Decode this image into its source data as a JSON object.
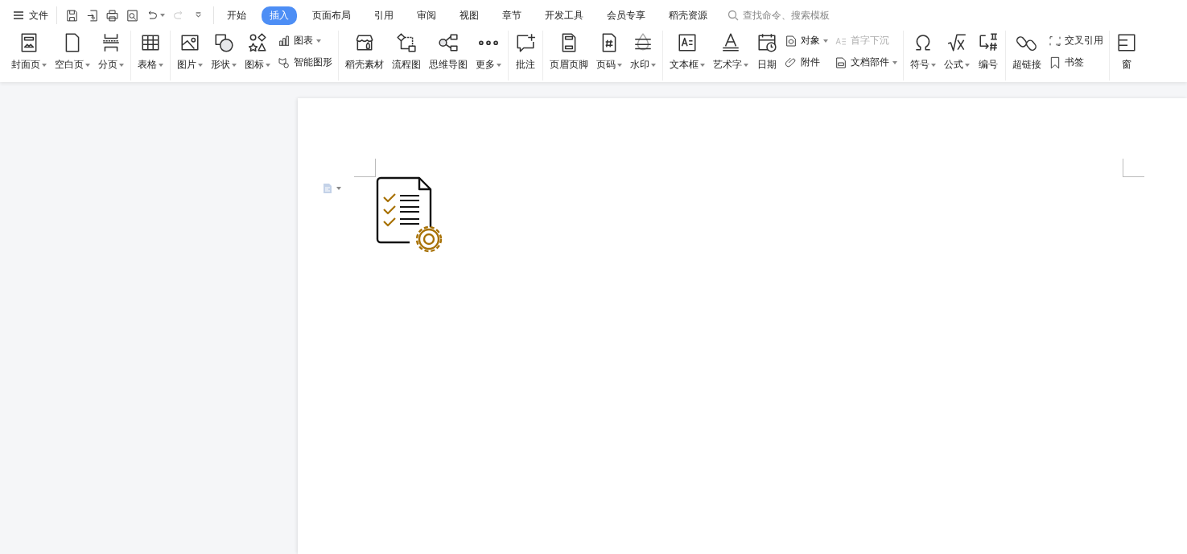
{
  "menu": {
    "label": "文件"
  },
  "quick_access": [
    {
      "dropdown": false,
      "disabled": false
    },
    {
      "dropdown": false,
      "disabled": false
    },
    {
      "dropdown": false,
      "disabled": false
    },
    {
      "dropdown": false,
      "disabled": false
    },
    {
      "dropdown": true,
      "disabled": false
    },
    {
      "dropdown": false,
      "disabled": true
    },
    {
      "dropdown": false,
      "disabled": false
    }
  ],
  "tabs": [
    {
      "label": "开始",
      "selected": false
    },
    {
      "label": "插入",
      "selected": true
    },
    {
      "label": "页面布局",
      "selected": false
    },
    {
      "label": "引用",
      "selected": false
    },
    {
      "label": "审阅",
      "selected": false
    },
    {
      "label": "视图",
      "selected": false
    },
    {
      "label": "章节",
      "selected": false
    },
    {
      "label": "开发工具",
      "selected": false
    },
    {
      "label": "会员专享",
      "selected": false
    },
    {
      "label": "稻壳资源",
      "selected": false
    }
  ],
  "search": {
    "placeholder": "查找命令、搜索模板"
  },
  "ribbon": [
    {
      "items": [
        {
          "kind": "big",
          "label": "封面页",
          "dropdown": true
        },
        {
          "kind": "big",
          "label": "空白页",
          "dropdown": true
        },
        {
          "kind": "big",
          "label": "分页",
          "dropdown": true
        }
      ]
    },
    {
      "items": [
        {
          "kind": "big",
          "label": "表格",
          "dropdown": true
        }
      ]
    },
    {
      "items": [
        {
          "kind": "big",
          "label": "图片",
          "dropdown": true
        },
        {
          "kind": "big",
          "label": "形状",
          "dropdown": true
        },
        {
          "kind": "big",
          "label": "图标",
          "dropdown": true
        },
        {
          "kind": "pair",
          "items": [
            {
              "label": "图表",
              "dropdown": true,
              "disabled": false
            },
            {
              "label": "智能图形",
              "dropdown": false,
              "disabled": false
            }
          ]
        }
      ]
    },
    {
      "items": [
        {
          "kind": "big",
          "label": "稻壳素材",
          "dropdown": false
        },
        {
          "kind": "big",
          "label": "流程图",
          "dropdown": false
        },
        {
          "kind": "big",
          "label": "思维导图",
          "dropdown": false
        },
        {
          "kind": "big",
          "label": "更多",
          "dropdown": true
        }
      ]
    },
    {
      "items": [
        {
          "kind": "big",
          "label": "批注",
          "dropdown": false
        }
      ]
    },
    {
      "items": [
        {
          "kind": "big",
          "label": "页眉页脚",
          "dropdown": false
        },
        {
          "kind": "big",
          "label": "页码",
          "dropdown": true
        },
        {
          "kind": "big",
          "label": "水印",
          "dropdown": true
        }
      ]
    },
    {
      "items": [
        {
          "kind": "big",
          "label": "文本框",
          "dropdown": true
        },
        {
          "kind": "big",
          "label": "艺术字",
          "dropdown": true
        },
        {
          "kind": "big",
          "label": "日期",
          "dropdown": false
        },
        {
          "kind": "pair",
          "items": [
            {
              "label": "对象",
              "dropdown": true,
              "disabled": false
            },
            {
              "label": "附件",
              "dropdown": false,
              "disabled": false
            }
          ]
        },
        {
          "kind": "pair",
          "items": [
            {
              "label": "首字下沉",
              "dropdown": false,
              "disabled": true
            },
            {
              "label": "文档部件",
              "dropdown": true,
              "disabled": false
            }
          ]
        }
      ]
    },
    {
      "items": [
        {
          "kind": "big",
          "label": "符号",
          "dropdown": true
        },
        {
          "kind": "big",
          "label": "公式",
          "dropdown": true
        },
        {
          "kind": "big",
          "label": "编号",
          "dropdown": false
        }
      ]
    },
    {
      "items": [
        {
          "kind": "big",
          "label": "超链接",
          "dropdown": false
        },
        {
          "kind": "pair",
          "items": [
            {
              "label": "交叉引用",
              "dropdown": false,
              "disabled": false
            },
            {
              "label": "书签",
              "dropdown": false,
              "disabled": false
            }
          ]
        }
      ]
    },
    {
      "items": [
        {
          "kind": "big",
          "label": "窗",
          "dropdown": false
        }
      ]
    }
  ]
}
